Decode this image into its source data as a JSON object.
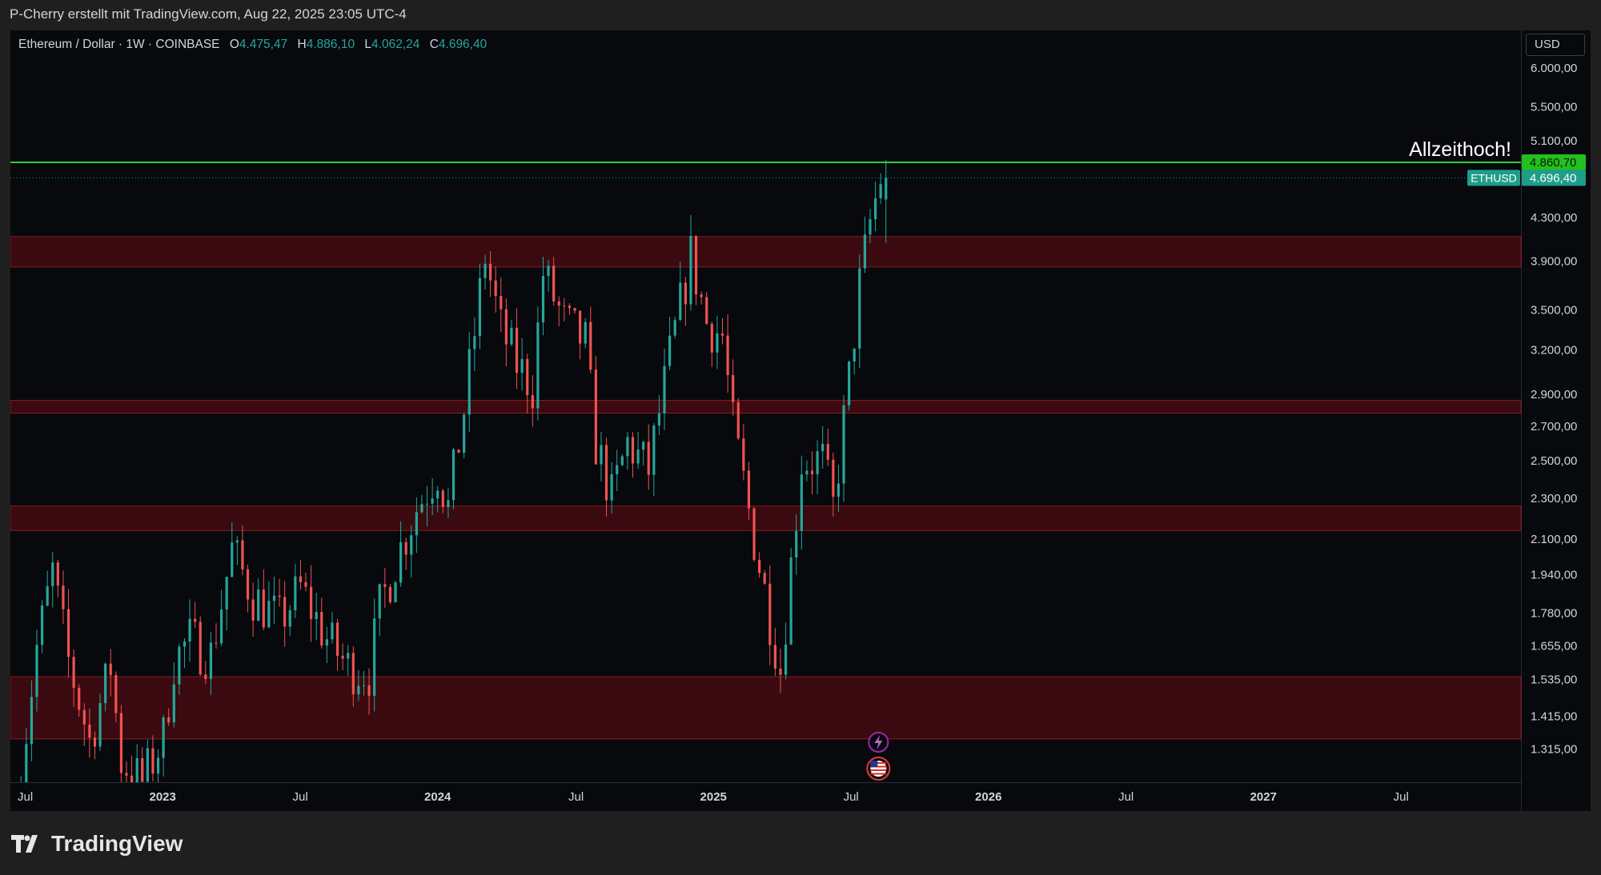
{
  "header": {
    "credit": "P-Cherry erstellt mit TradingView.com, Aug 22, 2025 23:05 UTC-4"
  },
  "symbol": {
    "name": "Ethereum / Dollar · 1W · COINBASE",
    "open_label": "O",
    "open": "4.475,47",
    "high_label": "H",
    "high": "4.886,10",
    "low_label": "L",
    "low": "4.062,24",
    "close_label": "C",
    "close": "4.696,40"
  },
  "currency": "USD",
  "footer": {
    "brand": "TradingView"
  },
  "colors": {
    "up": "#26a69a",
    "down": "#ef5350",
    "zone_fill": "#3a0a10",
    "zone_border": "#8b1a22",
    "ath_line": "#2fd12f",
    "price_tag": "#1e9e8a"
  },
  "icons": [
    "lightning-icon",
    "us-flag-icon",
    "tradingview-logo-icon"
  ],
  "chart_data": {
    "type": "candlestick",
    "scale": "log",
    "interval": "1W",
    "ylim": [
      1230,
      6500
    ],
    "yticks": [
      {
        "value": 6000,
        "label": "6.000,00"
      },
      {
        "value": 5500,
        "label": "5.500,00"
      },
      {
        "value": 5100,
        "label": "5.100,00"
      },
      {
        "value": 4300,
        "label": "4.300,00"
      },
      {
        "value": 3900,
        "label": "3.900,00"
      },
      {
        "value": 3500,
        "label": "3.500,00"
      },
      {
        "value": 3200,
        "label": "3.200,00"
      },
      {
        "value": 2900,
        "label": "2.900,00"
      },
      {
        "value": 2700,
        "label": "2.700,00"
      },
      {
        "value": 2500,
        "label": "2.500,00"
      },
      {
        "value": 2300,
        "label": "2.300,00"
      },
      {
        "value": 2100,
        "label": "2.100,00"
      },
      {
        "value": 1940,
        "label": "1.940,00"
      },
      {
        "value": 1780,
        "label": "1.780,00"
      },
      {
        "value": 1655,
        "label": "1.655,00"
      },
      {
        "value": 1535,
        "label": "1.535,00"
      },
      {
        "value": 1415,
        "label": "1.415,00"
      },
      {
        "value": 1315,
        "label": "1.315,00"
      }
    ],
    "xlim": [
      "2022-07-01",
      "2027-09-01"
    ],
    "xticks": [
      {
        "date": "2022-07-01",
        "label": "Jul"
      },
      {
        "date": "2023-01-01",
        "label": "2023"
      },
      {
        "date": "2023-07-01",
        "label": "Jul"
      },
      {
        "date": "2024-01-01",
        "label": "2024"
      },
      {
        "date": "2024-07-01",
        "label": "Jul"
      },
      {
        "date": "2025-01-01",
        "label": "2025"
      },
      {
        "date": "2025-07-01",
        "label": "Jul"
      },
      {
        "date": "2026-01-01",
        "label": "2026"
      },
      {
        "date": "2026-07-01",
        "label": "Jul"
      },
      {
        "date": "2027-01-01",
        "label": "2027"
      },
      {
        "date": "2027-07-01",
        "label": "Jul"
      }
    ],
    "zones": [
      {
        "low": 3850,
        "high": 4120
      },
      {
        "low": 2780,
        "high": 2860
      },
      {
        "low": 2140,
        "high": 2260
      },
      {
        "low": 1345,
        "high": 1545
      }
    ],
    "ath_line": {
      "value": 4860.7,
      "label": "4.860,70",
      "annotation": "Allzeithoch!"
    },
    "last_price": {
      "value": 4696.4,
      "label": "4.696,40",
      "symbol": "ETHUSD"
    },
    "events": [
      {
        "date": "2025-08-08",
        "icon": "lightning-icon"
      },
      {
        "date": "2025-08-08",
        "icon": "us-flag-icon"
      }
    ],
    "anchors": [
      {
        "date": "2022-06-27",
        "close": 1150
      },
      {
        "date": "2022-07-25",
        "close": 1650
      },
      {
        "date": "2022-08-15",
        "close": 1950
      },
      {
        "date": "2022-09-05",
        "close": 1600
      },
      {
        "date": "2022-10-03",
        "close": 1340
      },
      {
        "date": "2022-10-31",
        "close": 1580
      },
      {
        "date": "2022-11-14",
        "close": 1280
      },
      {
        "date": "2022-12-12",
        "close": 1220
      },
      {
        "date": "2023-01-09",
        "close": 1350
      },
      {
        "date": "2023-01-23",
        "close": 1600
      },
      {
        "date": "2023-02-13",
        "close": 1680
      },
      {
        "date": "2023-03-13",
        "close": 1620
      },
      {
        "date": "2023-04-10",
        "close": 2050
      },
      {
        "date": "2023-05-08",
        "close": 1850
      },
      {
        "date": "2023-06-12",
        "close": 1750
      },
      {
        "date": "2023-07-10",
        "close": 1880
      },
      {
        "date": "2023-08-14",
        "close": 1680
      },
      {
        "date": "2023-09-11",
        "close": 1580
      },
      {
        "date": "2023-10-09",
        "close": 1560
      },
      {
        "date": "2023-10-23",
        "close": 1800
      },
      {
        "date": "2023-11-13",
        "close": 2000
      },
      {
        "date": "2023-12-11",
        "close": 2250
      },
      {
        "date": "2024-01-08",
        "close": 2450
      },
      {
        "date": "2024-01-22",
        "close": 2250
      },
      {
        "date": "2024-02-12",
        "close": 2800
      },
      {
        "date": "2024-03-11",
        "close": 3950
      },
      {
        "date": "2024-04-01",
        "close": 3350
      },
      {
        "date": "2024-04-22",
        "close": 3100
      },
      {
        "date": "2024-05-13",
        "close": 2950
      },
      {
        "date": "2024-05-27",
        "close": 3800
      },
      {
        "date": "2024-06-24",
        "close": 3400
      },
      {
        "date": "2024-07-22",
        "close": 3250
      },
      {
        "date": "2024-08-05",
        "close": 2600
      },
      {
        "date": "2024-08-26",
        "close": 2300
      },
      {
        "date": "2024-09-16",
        "close": 2600
      },
      {
        "date": "2024-10-14",
        "close": 2450
      },
      {
        "date": "2024-11-11",
        "close": 3150
      },
      {
        "date": "2024-12-09",
        "close": 3950
      },
      {
        "date": "2024-12-30",
        "close": 3400
      },
      {
        "date": "2025-01-20",
        "close": 3300
      },
      {
        "date": "2025-02-03",
        "close": 2700
      },
      {
        "date": "2025-03-03",
        "close": 2100
      },
      {
        "date": "2025-04-07",
        "close": 1570
      },
      {
        "date": "2025-05-05",
        "close": 2500
      },
      {
        "date": "2025-06-02",
        "close": 2500
      },
      {
        "date": "2025-06-16",
        "close": 2250
      },
      {
        "date": "2025-07-07",
        "close": 3000
      },
      {
        "date": "2025-07-21",
        "close": 3700
      },
      {
        "date": "2025-08-04",
        "close": 4250
      },
      {
        "date": "2025-08-18",
        "close": 4696
      }
    ]
  }
}
